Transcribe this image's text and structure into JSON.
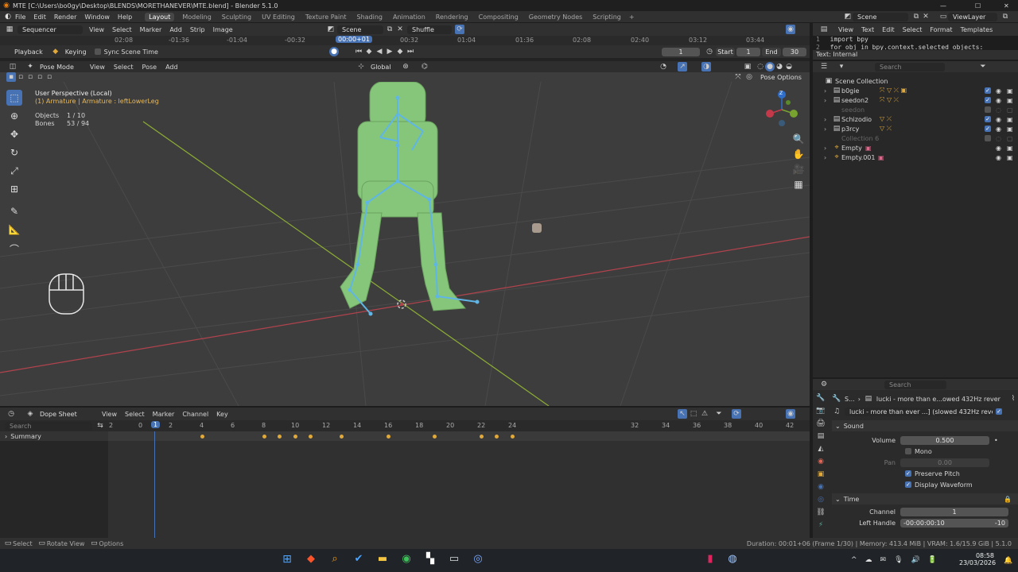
{
  "titlebar": {
    "title": "MTE [C:\\Users\\bo0gy\\Desktop\\BLENDS\\MORETHANEVER\\MTE.blend] - Blender 5.1.0",
    "min": "—",
    "max": "☐",
    "close": "✕"
  },
  "menu": [
    "File",
    "Edit",
    "Render",
    "Window",
    "Help"
  ],
  "workspaces": [
    "Layout",
    "Modeling",
    "Sculpting",
    "UV Editing",
    "Texture Paint",
    "Shading",
    "Animation",
    "Rendering",
    "Compositing",
    "Geometry Nodes",
    "Scripting"
  ],
  "workspace_add": "+",
  "scene": {
    "name": "Scene",
    "viewlayer": "ViewLayer"
  },
  "sequencer": {
    "editor": "Sequencer",
    "menus": [
      "View",
      "Select",
      "Marker",
      "Add",
      "Strip",
      "Image"
    ],
    "scene": "Scene",
    "mode": "Shuffle",
    "ruler": [
      "02:08",
      "-01:36",
      "-01:04",
      "-00:32",
      "00:00+01",
      "00:32",
      "01:04",
      "01:36",
      "02:08",
      "02:40",
      "03:12",
      "03:44"
    ],
    "playback": "Playback",
    "keying": "Keying",
    "sync": "Sync Scene Time",
    "current_frame": "1",
    "start_label": "Start",
    "start": "1",
    "end_label": "End",
    "end": "30"
  },
  "text_editor": {
    "menus": [
      "View",
      "Text",
      "Edit",
      "Select",
      "Format",
      "Templates"
    ],
    "lines": [
      {
        "n": "1",
        "code": "import bpy"
      },
      {
        "n": "2",
        "code": "for obj in bpy.context.selected_objects:"
      }
    ],
    "status": "Text: Internal"
  },
  "viewport": {
    "mode": "Pose Mode",
    "menus": [
      "View",
      "Select",
      "Pose",
      "Add"
    ],
    "orientation": "Global",
    "pose_options": "Pose Options",
    "perspective": "User Perspective (Local)",
    "active": "(1) Armature | Armature : leftLowerLeg",
    "objects_label": "Objects",
    "objects": "1 / 10",
    "bones_label": "Bones",
    "bones": "53 / 94",
    "gizmo": {
      "z": "Z",
      "y": "Y",
      "x": "X"
    }
  },
  "outliner": {
    "search": "Search",
    "root": "Scene Collection",
    "items": [
      {
        "name": "b0gie",
        "dim": false,
        "expand": "›"
      },
      {
        "name": "seedon2",
        "dim": false,
        "expand": "›"
      },
      {
        "name": "seedon",
        "dim": true,
        "expand": ""
      },
      {
        "name": "Schizodio",
        "dim": false,
        "expand": "›"
      },
      {
        "name": "p3rcy",
        "dim": false,
        "expand": "›"
      },
      {
        "name": "Collection 6",
        "dim": true,
        "expand": ""
      },
      {
        "name": "Empty",
        "dim": false,
        "expand": "›"
      },
      {
        "name": "Empty.001",
        "dim": false,
        "expand": "›"
      }
    ]
  },
  "properties": {
    "search": "Search",
    "breadcrumb_scene": "S...",
    "breadcrumb_strip": "lucki - more than e...owed  432Hz  rever",
    "strip_name": "lucki - more than ever ...] (slowed  432Hz  rever",
    "sound_panel": "Sound",
    "volume_label": "Volume",
    "volume": "0.500",
    "mono": "Mono",
    "pan_label": "Pan",
    "pan": "0.00",
    "preserve_pitch": "Preserve Pitch",
    "display_waveform": "Display Waveform",
    "time_panel": "Time",
    "channel_label": "Channel",
    "channel": "1",
    "left_handle_label": "Left Handle",
    "left_handle": "-00:00:00:10",
    "left_handle_val": "-10"
  },
  "dopesheet": {
    "editor": "Dope Sheet",
    "menus": [
      "View",
      "Select",
      "Marker",
      "Channel",
      "Key"
    ],
    "search": "Search",
    "summary": "Summary",
    "ticks": [
      "2",
      "0",
      "1",
      "2",
      "4",
      "6",
      "8",
      "10",
      "12",
      "14",
      "16",
      "18",
      "20",
      "22",
      "24",
      "32",
      "34",
      "36",
      "38",
      "40",
      "42"
    ],
    "keyframes": [
      4,
      8,
      9,
      10,
      11,
      13,
      16,
      19,
      22,
      23,
      24
    ]
  },
  "statusbar": {
    "select": "Select",
    "rotate": "Rotate View",
    "options": "Options",
    "info": "Duration: 00:01+06 (Frame 1/30) | Memory: 413.4 MiB | VRAM: 1.6/15.9 GiB | 5.1.0"
  },
  "taskbar": {
    "time": "08:58",
    "date": "23/03/2026",
    "start_icon": "⊞",
    "tray": [
      "^",
      "☁",
      "✉",
      "🎙",
      "🔊",
      "🔋"
    ]
  },
  "colors": {
    "accent": "#4772b3",
    "key": "#e0a93a",
    "viewport_bg": "#3d3d3d",
    "armature": "#86c67a",
    "bone": "#5fb6e6"
  }
}
